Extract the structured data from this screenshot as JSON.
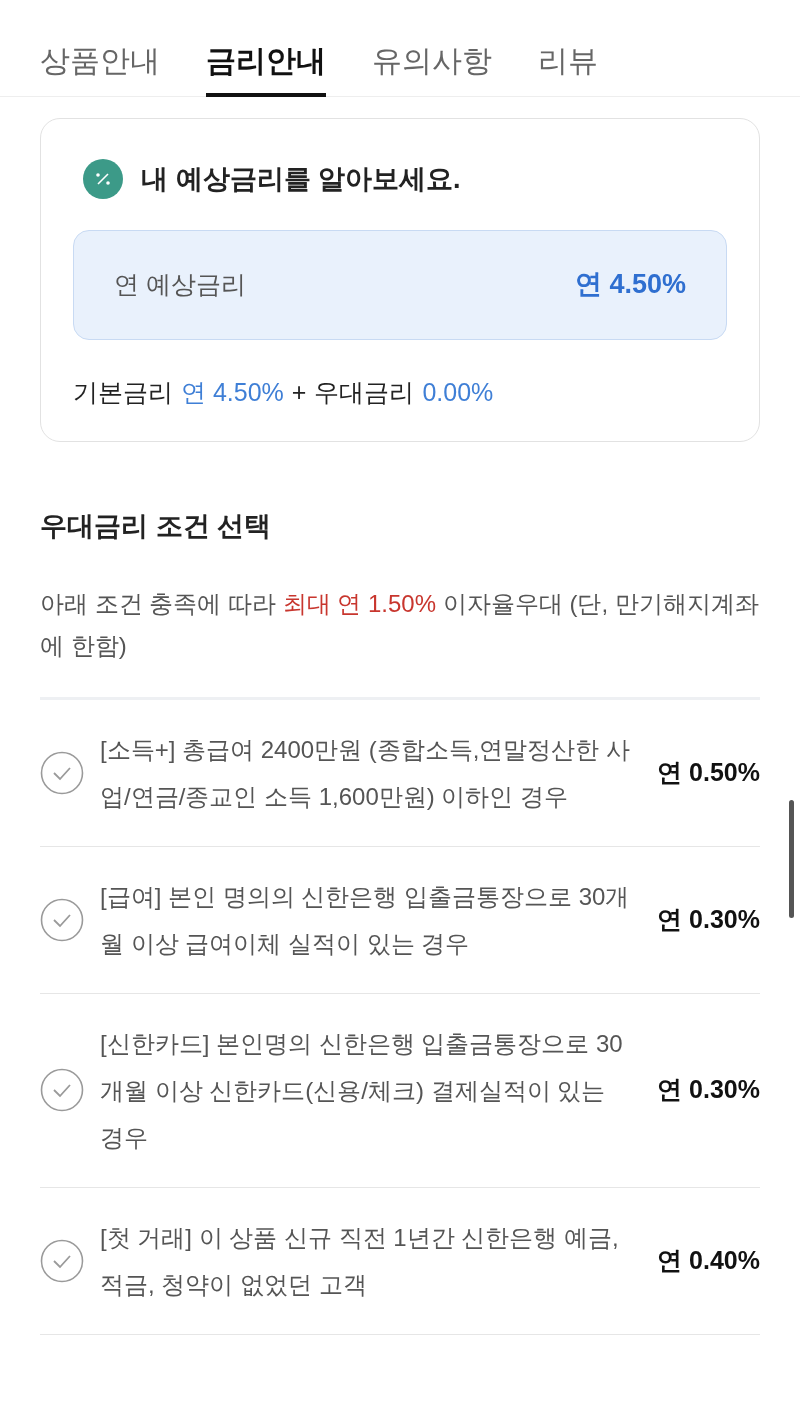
{
  "tabs": [
    {
      "label": "상품안내",
      "selected": false
    },
    {
      "label": "금리안내",
      "selected": true
    },
    {
      "label": "유의사항",
      "selected": false
    },
    {
      "label": "리뷰",
      "selected": false
    }
  ],
  "rate_card": {
    "title": "내 예상금리를 알아보세요.",
    "summary_label": "연 예상금리",
    "summary_value": "연 4.50%",
    "base_label": "기본금리",
    "base_value": "연 4.50%",
    "plus": "+",
    "bonus_label": "우대금리",
    "bonus_value": "0.00%"
  },
  "conditions_section": {
    "title": "우대금리 조건 선택",
    "description_before": "아래 조건 충족에 따라 ",
    "description_highlight": "최대 연 1.50%",
    "description_after": " 이자율우대 (단, 만기해지계좌에 한함)",
    "items": [
      {
        "text": "[소득+] 총급여 2400만원 (종합소득,연말정산한 사업/연금/종교인 소득 1,600만원) 이하인 경우",
        "rate": "연 0.50%",
        "checked": false
      },
      {
        "text": "[급여] 본인 명의의 신한은행 입출금통장으로 30개월 이상 급여이체 실적이 있는 경우",
        "rate": "연 0.30%",
        "checked": false
      },
      {
        "text": "[신한카드] 본인명의 신한은행 입출금통장으로 30개월 이상 신한카드(신용/체크) 결제실적이 있는 경우",
        "rate": "연 0.30%",
        "checked": false
      },
      {
        "text": "[첫 거래] 이 상품 신규 직전 1년간 신한은행 예금, 적금, 청약이 없었던 고객",
        "rate": "연 0.40%",
        "checked": false
      }
    ]
  }
}
